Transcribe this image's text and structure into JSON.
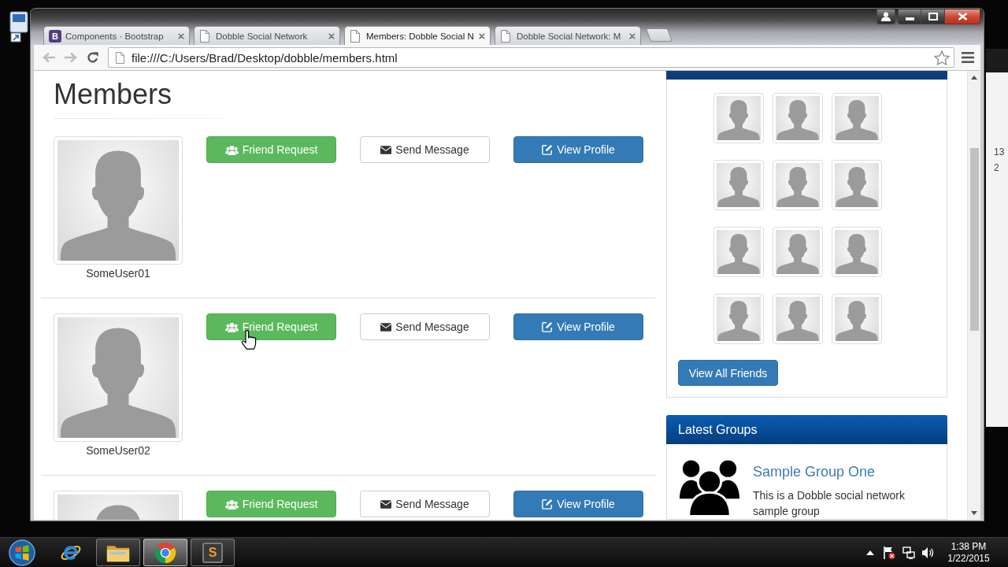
{
  "browser": {
    "tabs": [
      {
        "label": "Components · Bootstrap",
        "favicon_text": "B",
        "selected": false
      },
      {
        "label": "Dobble Social Network",
        "selected": false
      },
      {
        "label": "Members: Dobble Social N",
        "selected": true
      },
      {
        "label": "Dobble Social Network: M",
        "selected": false
      }
    ],
    "navigation": [
      {
        "kind": "back",
        "disabled": true
      },
      {
        "kind": "forward",
        "disabled": true
      },
      {
        "kind": "reload",
        "disabled": false
      }
    ],
    "address": "file:///C:/Users/Brad/Desktop/dobble/members.html"
  },
  "page": {
    "heading": "Members",
    "members": [
      {
        "name": "SomeUser01",
        "actions": [
          {
            "label": "Friend Request",
            "kind": "request"
          },
          {
            "label": "Send Message",
            "kind": "message"
          },
          {
            "label": "View Profile",
            "kind": "profile"
          }
        ]
      },
      {
        "name": "SomeUser02",
        "actions": [
          {
            "label": "Friend Request",
            "kind": "request"
          },
          {
            "label": "Send Message",
            "kind": "message"
          },
          {
            "label": "View Profile",
            "kind": "profile"
          }
        ]
      },
      {
        "actions": [
          {
            "label": "Friend Request",
            "kind": "request"
          },
          {
            "label": "Send Message",
            "kind": "message"
          },
          {
            "label": "View Profile",
            "kind": "profile"
          }
        ]
      }
    ],
    "friends_panel": {
      "friends": [
        {
          "kind": "avatar"
        },
        {
          "kind": "avatar"
        },
        {
          "kind": "avatar"
        },
        {
          "kind": "avatar"
        },
        {
          "kind": "avatar"
        },
        {
          "kind": "avatar"
        },
        {
          "kind": "avatar"
        },
        {
          "kind": "avatar"
        },
        {
          "kind": "avatar"
        },
        {
          "kind": "avatar"
        },
        {
          "kind": "avatar"
        },
        {
          "kind": "avatar"
        }
      ],
      "button": "View All Friends"
    },
    "groups_panel": {
      "title": "Latest Groups",
      "groups": [
        {
          "name": "Sample Group One",
          "description": "This is a Dobble social network sample group"
        }
      ]
    }
  },
  "taskbar": {
    "items": [
      {
        "kind": "start",
        "running": false,
        "selected": false
      },
      {
        "kind": "web",
        "running": false,
        "selected": false
      },
      {
        "kind": "folder",
        "running": true,
        "selected": false
      },
      {
        "kind": "browser",
        "running": true,
        "selected": true
      },
      {
        "kind": "editor",
        "label": "S",
        "running": true,
        "selected": false
      }
    ],
    "clock": {
      "time": "1:38 PM",
      "date": "1/22/2015"
    }
  },
  "background_window": {
    "texts": [
      "13",
      "2"
    ]
  }
}
